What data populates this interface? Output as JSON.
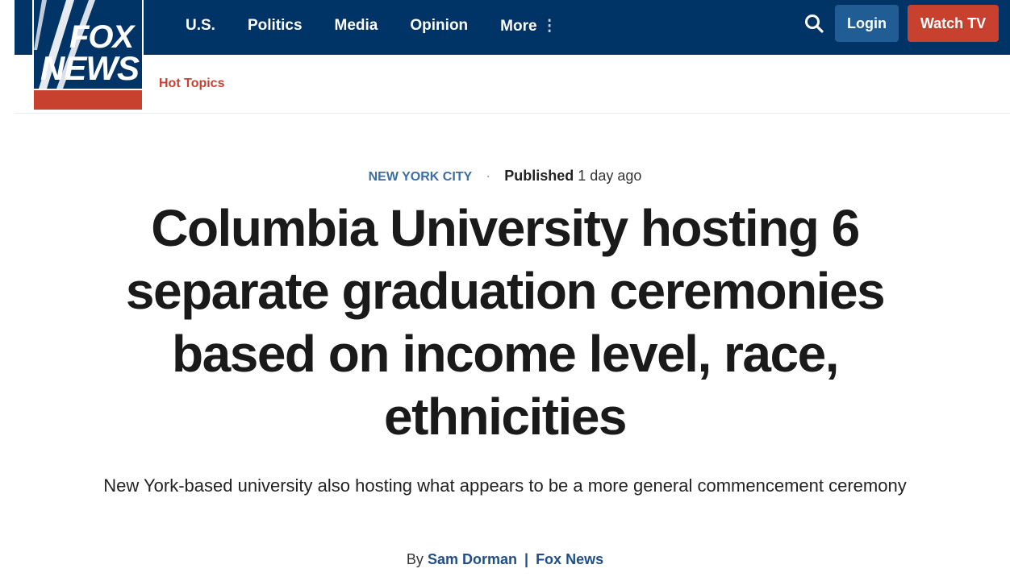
{
  "brand": {
    "logo_line1": "FOX",
    "logo_line2": "NEWS",
    "colors": {
      "navy": "#003366",
      "red": "#c8412f",
      "login_blue": "#1f5d94",
      "link_blue": "#3a6ea5"
    }
  },
  "nav": {
    "items": [
      {
        "label": "U.S."
      },
      {
        "label": "Politics"
      },
      {
        "label": "Media"
      },
      {
        "label": "Opinion"
      },
      {
        "label": "More"
      }
    ],
    "more_icon": "⋮",
    "search_icon": "search-icon",
    "login_label": "Login",
    "watch_label": "Watch TV"
  },
  "subnav": {
    "hot_topics": "Hot Topics"
  },
  "article": {
    "category": "NEW YORK CITY",
    "published_label": "Published",
    "published_time": "1 day ago",
    "headline": "Columbia University hosting 6 separate graduation ceremonies based on income level, race, ethnicities",
    "subheadline": "New York-based university also hosting what appears to be a more general commencement ceremony",
    "byline_prefix": "By",
    "author": "Sam Dorman",
    "byline_separator": "|",
    "outlet": "Fox News"
  }
}
